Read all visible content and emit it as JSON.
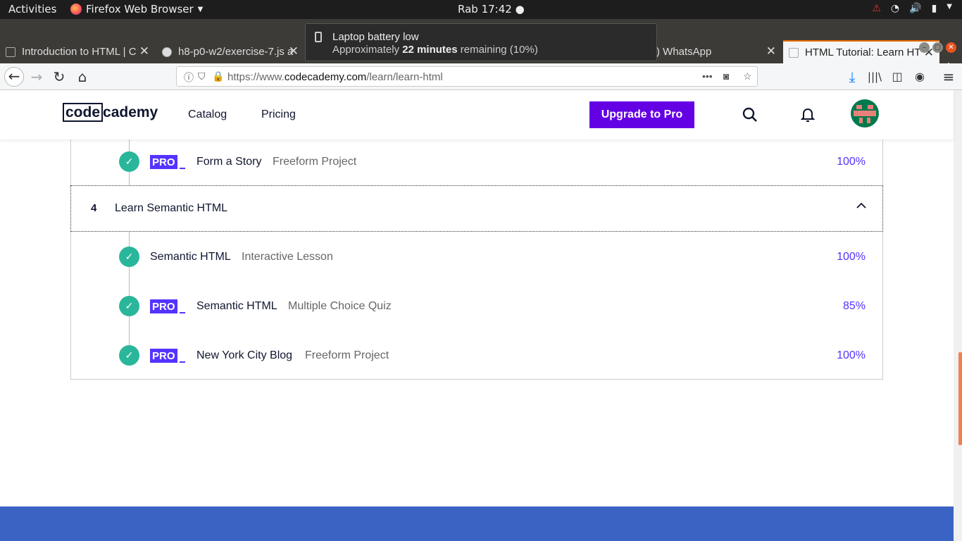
{
  "system": {
    "activities": "Activities",
    "app_name": "Firefox Web Browser",
    "clock": "Rab 17:42"
  },
  "tabs": [
    {
      "title": "Introduction to HTML | C"
    },
    {
      "title": "h8-p0-w2/exercise-7.js a"
    },
    {
      "title": ") WhatsApp"
    },
    {
      "title": "HTML Tutorial: Learn HT"
    }
  ],
  "notification": {
    "title": "Laptop battery low",
    "message_prefix": "Approximately ",
    "message_bold": "22 minutes",
    "message_suffix": " remaining (10%)"
  },
  "urlbar": {
    "url_prefix": "https://www.",
    "url_domain": "codecademy.com",
    "url_path": "/learn/learn-html"
  },
  "site": {
    "logo_left": "code",
    "logo_right": "cademy",
    "nav_catalog": "Catalog",
    "nav_pricing": "Pricing",
    "upgrade": "Upgrade to Pro"
  },
  "lessons_top": [
    {
      "pro": "PRO",
      "name": "Form a Story",
      "type": "Freeform Project",
      "percent": "100%"
    }
  ],
  "section": {
    "number": "4",
    "title": "Learn Semantic HTML"
  },
  "lessons": [
    {
      "pro": "",
      "name": "Semantic HTML",
      "type": "Interactive Lesson",
      "percent": "100%"
    },
    {
      "pro": "PRO",
      "name": "Semantic HTML",
      "type": "Multiple Choice Quiz",
      "percent": "85%"
    },
    {
      "pro": "PRO",
      "name": "New York City Blog",
      "type": "Freeform Project",
      "percent": "100%"
    }
  ],
  "colors": {
    "brand_purple": "#6400e4",
    "pro_badge": "#5533ff",
    "check_green": "#2ab69a",
    "footer_blue": "#3a63c4"
  }
}
